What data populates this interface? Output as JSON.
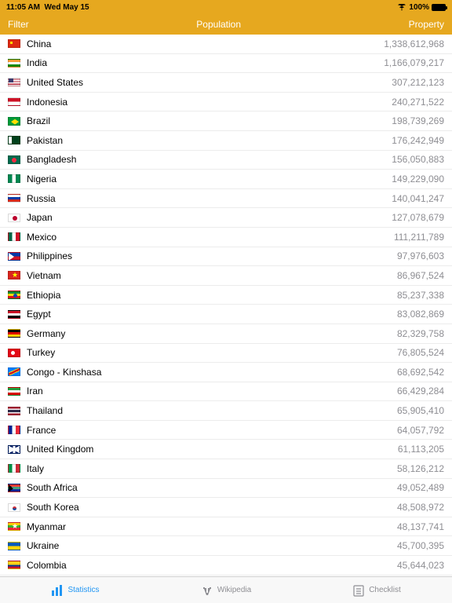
{
  "status": {
    "time": "11:05 AM",
    "date": "Wed May 15",
    "battery": "100%"
  },
  "nav": {
    "left": "Filter",
    "title": "Population",
    "right": "Property"
  },
  "rows": [
    {
      "flag": "cn",
      "country": "China",
      "value": "1,338,612,968"
    },
    {
      "flag": "in",
      "country": "India",
      "value": "1,166,079,217"
    },
    {
      "flag": "us",
      "country": "United States",
      "value": "307,212,123"
    },
    {
      "flag": "id",
      "country": "Indonesia",
      "value": "240,271,522"
    },
    {
      "flag": "br",
      "country": "Brazil",
      "value": "198,739,269"
    },
    {
      "flag": "pk",
      "country": "Pakistan",
      "value": "176,242,949"
    },
    {
      "flag": "bd",
      "country": "Bangladesh",
      "value": "156,050,883"
    },
    {
      "flag": "ng",
      "country": "Nigeria",
      "value": "149,229,090"
    },
    {
      "flag": "ru",
      "country": "Russia",
      "value": "140,041,247"
    },
    {
      "flag": "jp",
      "country": "Japan",
      "value": "127,078,679"
    },
    {
      "flag": "mx",
      "country": "Mexico",
      "value": "111,211,789"
    },
    {
      "flag": "ph",
      "country": "Philippines",
      "value": "97,976,603"
    },
    {
      "flag": "vn",
      "country": "Vietnam",
      "value": "86,967,524"
    },
    {
      "flag": "et",
      "country": "Ethiopia",
      "value": "85,237,338"
    },
    {
      "flag": "eg",
      "country": "Egypt",
      "value": "83,082,869"
    },
    {
      "flag": "de",
      "country": "Germany",
      "value": "82,329,758"
    },
    {
      "flag": "tr",
      "country": "Turkey",
      "value": "76,805,524"
    },
    {
      "flag": "cd",
      "country": "Congo - Kinshasa",
      "value": "68,692,542"
    },
    {
      "flag": "ir",
      "country": "Iran",
      "value": "66,429,284"
    },
    {
      "flag": "th",
      "country": "Thailand",
      "value": "65,905,410"
    },
    {
      "flag": "fr",
      "country": "France",
      "value": "64,057,792"
    },
    {
      "flag": "gb",
      "country": "United Kingdom",
      "value": "61,113,205"
    },
    {
      "flag": "it",
      "country": "Italy",
      "value": "58,126,212"
    },
    {
      "flag": "za",
      "country": "South Africa",
      "value": "49,052,489"
    },
    {
      "flag": "kr",
      "country": "South Korea",
      "value": "48,508,972"
    },
    {
      "flag": "mm",
      "country": "Myanmar",
      "value": "48,137,741"
    },
    {
      "flag": "ua",
      "country": "Ukraine",
      "value": "45,700,395"
    },
    {
      "flag": "co",
      "country": "Colombia",
      "value": "45,644,023"
    }
  ],
  "tabs": {
    "statistics": "Statistics",
    "wikipedia": "Wikipedia",
    "checklist": "Checklist"
  }
}
